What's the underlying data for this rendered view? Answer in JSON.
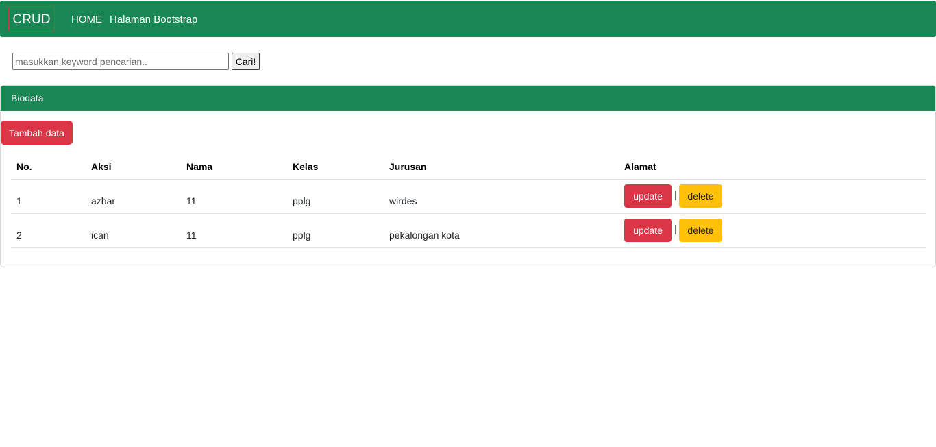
{
  "navbar": {
    "brand": "CRUD",
    "links": [
      "HOME",
      "Halaman Bootstrap"
    ]
  },
  "search": {
    "placeholder": "masukkan keyword pencarian..",
    "value": "",
    "button_label": "Cari!"
  },
  "card": {
    "title": "Biodata",
    "add_button_label": "Tambah data",
    "table": {
      "headers": [
        "No.",
        "Aksi",
        "Nama",
        "Kelas",
        "Jurusan",
        "Alamat"
      ],
      "rows": [
        {
          "no": "1",
          "aksi": "azhar",
          "nama": "11",
          "kelas": "pplg",
          "jurusan": "wirdes",
          "update_label": "update",
          "separator": "|",
          "delete_label": "delete"
        },
        {
          "no": "2",
          "aksi": "ican",
          "nama": "11",
          "kelas": "pplg",
          "jurusan": "pekalongan kota",
          "update_label": "update",
          "separator": "|",
          "delete_label": "delete"
        }
      ]
    }
  },
  "colors": {
    "primary_green": "#198754",
    "danger_red": "#dc3545",
    "warning_yellow": "#ffc107"
  }
}
